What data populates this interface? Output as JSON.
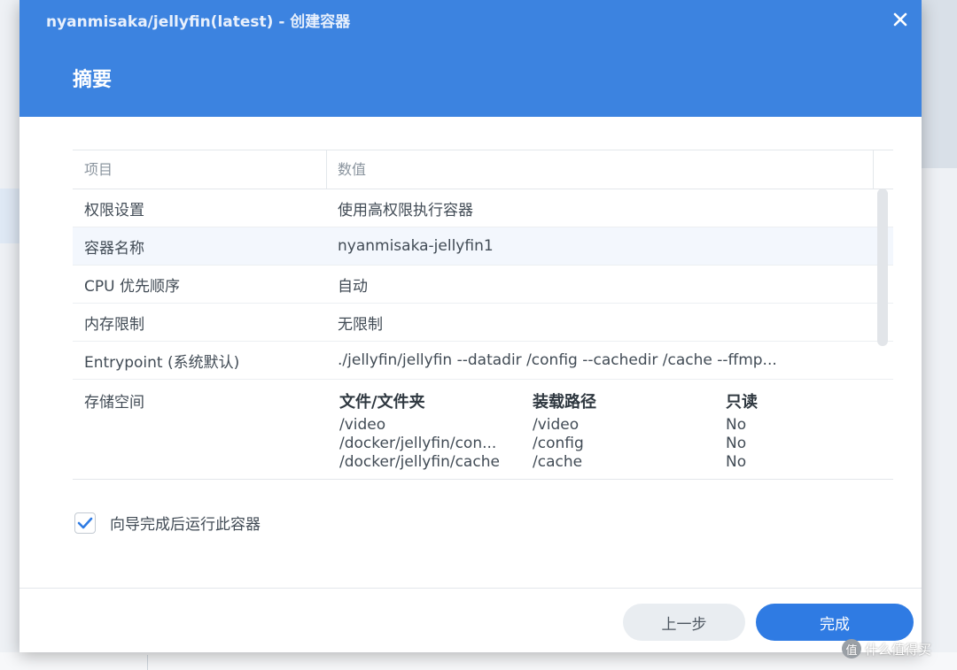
{
  "dialog": {
    "title": "nyanmisaka/jellyfin(latest) - 创建容器",
    "heading": "摘要"
  },
  "table": {
    "headers": [
      "项目",
      "数值"
    ],
    "rows": [
      {
        "label": "权限设置",
        "value": "使用高权限执行容器"
      },
      {
        "label": "容器名称",
        "value": "nyanmisaka-jellyfin1"
      },
      {
        "label": "CPU 优先顺序",
        "value": "自动"
      },
      {
        "label": "内存限制",
        "value": "无限制"
      },
      {
        "label": "Entrypoint (系统默认)",
        "value": "./jellyfin/jellyfin --datadir /config --cachedir /cache --ffmp..."
      }
    ],
    "storage": {
      "label": "存储空间",
      "headers": [
        "文件/文件夹",
        "装载路径",
        "只读"
      ],
      "rows": [
        [
          "/video",
          "/video",
          "No"
        ],
        [
          "/docker/jellyfin/con...",
          "/config",
          "No"
        ],
        [
          "/docker/jellyfin/cache",
          "/cache",
          "No"
        ]
      ]
    }
  },
  "checkbox": {
    "label": "向导完成后运行此容器",
    "checked": true
  },
  "buttons": {
    "prev": "上一步",
    "done": "完成"
  },
  "watermark": {
    "badge": "值",
    "text": "什么值得买"
  },
  "colors": {
    "header": "#3c83e0",
    "primary_button": "#2f7be3",
    "check": "#2f7be3"
  }
}
